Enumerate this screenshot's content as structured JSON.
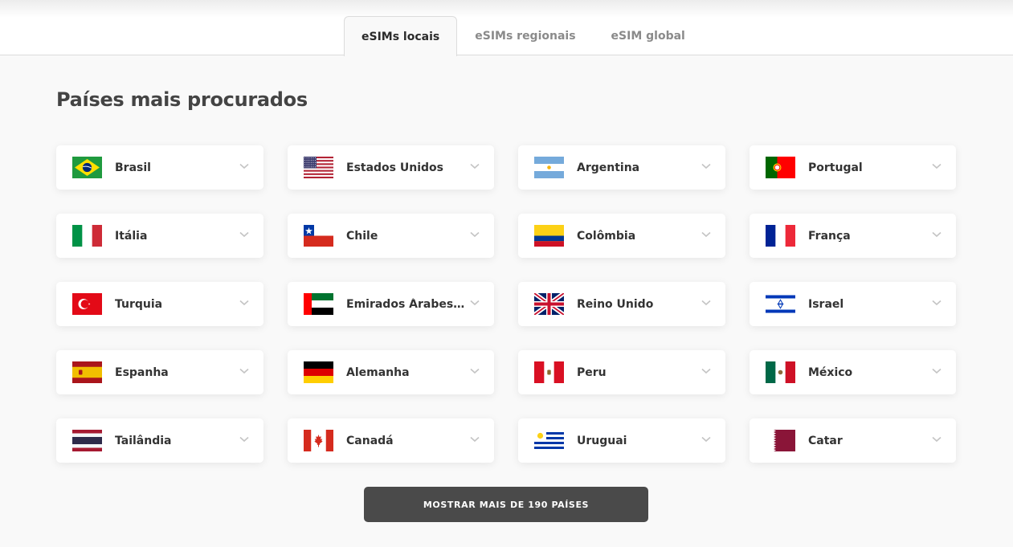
{
  "tabs": [
    {
      "label": "eSIMs locais",
      "active": true
    },
    {
      "label": "eSIMs regionais",
      "active": false
    },
    {
      "label": "eSIM global",
      "active": false
    }
  ],
  "page_title": "Países mais procurados",
  "countries": [
    {
      "name": "Brasil",
      "flag": "flag-brazil-icon"
    },
    {
      "name": "Estados Unidos",
      "flag": "flag-usa-icon"
    },
    {
      "name": "Argentina",
      "flag": "flag-argentina-icon"
    },
    {
      "name": "Portugal",
      "flag": "flag-portugal-icon"
    },
    {
      "name": "Itália",
      "flag": "flag-italy-icon"
    },
    {
      "name": "Chile",
      "flag": "flag-chile-icon"
    },
    {
      "name": "Colômbia",
      "flag": "flag-colombia-icon"
    },
    {
      "name": "França",
      "flag": "flag-france-icon"
    },
    {
      "name": "Turquia",
      "flag": "flag-turkey-icon"
    },
    {
      "name": "Emirados Árabes Unidos",
      "flag": "flag-uae-icon"
    },
    {
      "name": "Reino Unido",
      "flag": "flag-uk-icon"
    },
    {
      "name": "Israel",
      "flag": "flag-israel-icon"
    },
    {
      "name": "Espanha",
      "flag": "flag-spain-icon"
    },
    {
      "name": "Alemanha",
      "flag": "flag-germany-icon"
    },
    {
      "name": "Peru",
      "flag": "flag-peru-icon"
    },
    {
      "name": "México",
      "flag": "flag-mexico-icon"
    },
    {
      "name": "Tailândia",
      "flag": "flag-thailand-icon"
    },
    {
      "name": "Canadá",
      "flag": "flag-canada-icon"
    },
    {
      "name": "Uruguai",
      "flag": "flag-uruguay-icon"
    },
    {
      "name": "Catar",
      "flag": "flag-qatar-icon"
    }
  ],
  "more_button": "MOSTRAR MAIS DE 190 PAÍSES",
  "colors": {
    "button_bg": "#4a4a4a",
    "page_bg": "#f9f9f9",
    "card_bg": "#ffffff",
    "title": "#444444",
    "tab_inactive": "#8a8a8a"
  }
}
